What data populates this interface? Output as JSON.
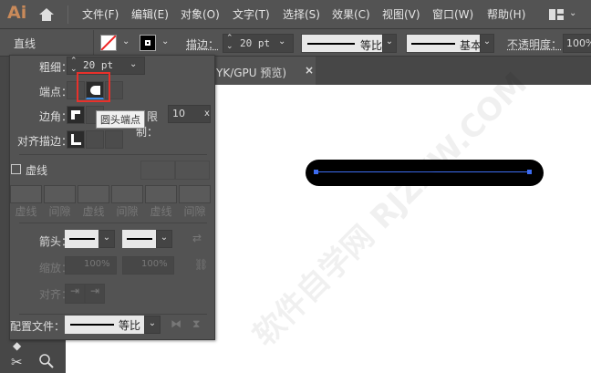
{
  "app": {
    "logo": "Ai",
    "menus": [
      "文件(F)",
      "编辑(E)",
      "对象(O)",
      "文字(T)",
      "选择(S)",
      "效果(C)",
      "视图(V)",
      "窗口(W)",
      "帮助(H)"
    ]
  },
  "control": {
    "tool_name": "直线",
    "stroke_label": "描边：",
    "stroke_value": "20 pt",
    "profile1": "等比",
    "profile2": "基本",
    "opacity_label": "不透明度：",
    "opacity_value": "100%"
  },
  "document": {
    "tab_title": "YK/GPU 预览)",
    "close": "×"
  },
  "panel": {
    "weight_label": "粗细：",
    "weight_value": "20 pt",
    "cap_label": "端点：",
    "corner_label": "边角：",
    "limit_label": "限制：",
    "limit_value": "10",
    "limit_unit": "x",
    "align_label": "对齐描边：",
    "tooltip": "圆头端点",
    "dashed_label": "虚线",
    "dash_fields": [
      "虚线",
      "间隙",
      "虚线",
      "间隙",
      "虚线",
      "间隙"
    ],
    "arrow_label": "箭头：",
    "scale_label": "缩放：",
    "scale1": "100%",
    "scale2": "100%",
    "arrow_align_label": "对齐：",
    "profile_label": "配置文件：",
    "profile_value": "等比"
  },
  "colors": {
    "accent": "#3d8ee8",
    "highlight": "#e8312b"
  },
  "watermark": "软件自学网 RJZXW.COM"
}
